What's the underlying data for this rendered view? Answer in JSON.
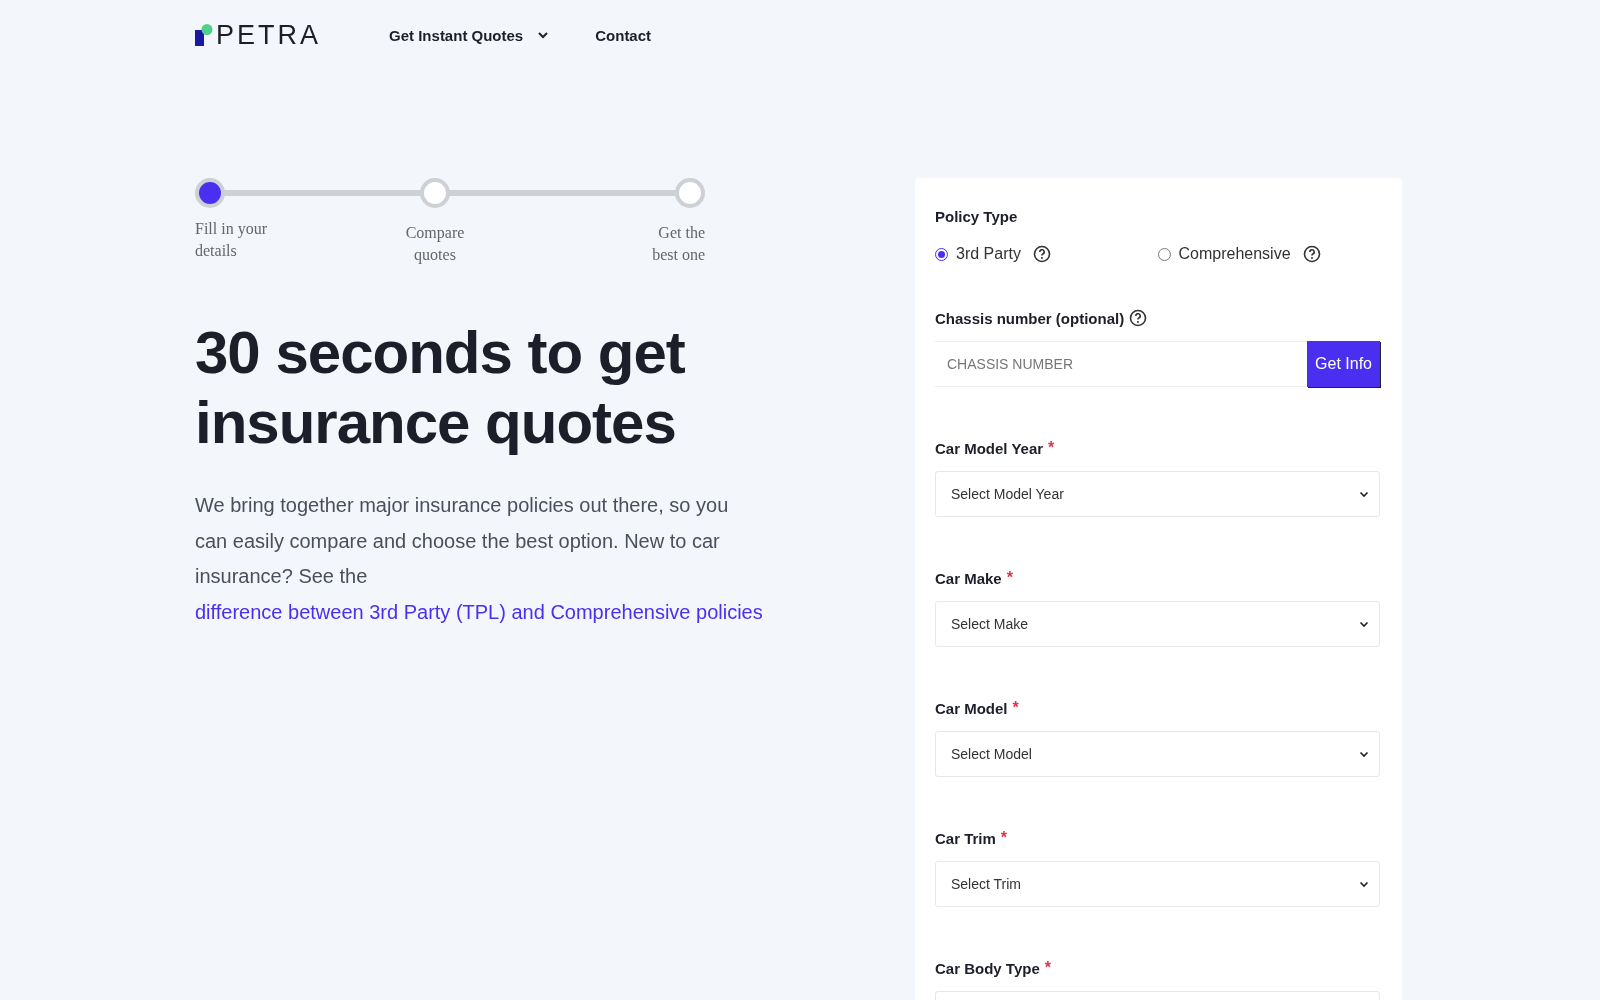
{
  "header": {
    "logo": "PETRA",
    "nav": [
      {
        "label": "Get Instant Quotes",
        "dropdown": true
      },
      {
        "label": "Contact",
        "dropdown": false
      }
    ]
  },
  "steps": [
    {
      "label": "Fill in your details",
      "selected": true
    },
    {
      "label": "Compare quotes",
      "selected": false
    },
    {
      "label": "Get the best one",
      "selected": false
    }
  ],
  "hero": {
    "title": "30 seconds to get insurance quotes",
    "text": "We bring together major insurance policies out there, so you can easily compare and choose the best option. New to car insurance? See the",
    "link": "difference between 3rd Party (TPL) and Comprehensive policies"
  },
  "form": {
    "policy_type": {
      "label": "Policy Type",
      "options": [
        {
          "label": "3rd Party",
          "selected": true
        },
        {
          "label": "Comprehensive",
          "selected": false
        }
      ]
    },
    "chassis": {
      "label": "Chassis number (optional)",
      "placeholder": "CHASSIS NUMBER",
      "button": "Get Info"
    },
    "fields": [
      {
        "label": "Car Model Year",
        "marker": "*",
        "placeholder": "Select Model Year"
      },
      {
        "label": "Car Make",
        "marker": "*",
        "placeholder": "Select Make"
      },
      {
        "label": "Car Model",
        "marker": "*",
        "placeholder": "Select Model"
      },
      {
        "label": "Car Trim",
        "marker": "*",
        "placeholder": "Select Trim"
      },
      {
        "label": "Car Body Type",
        "marker": "*"
      }
    ]
  }
}
